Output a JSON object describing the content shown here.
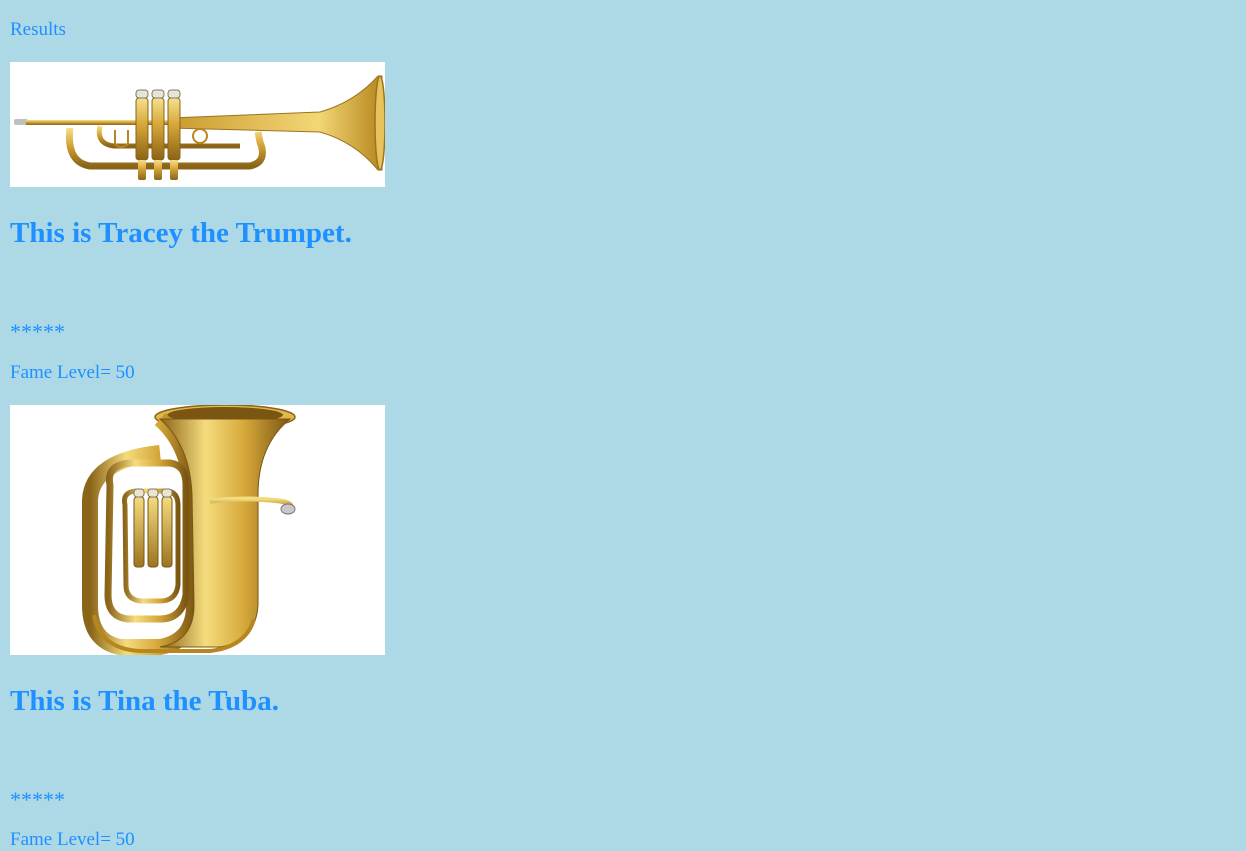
{
  "page": {
    "heading": "Results",
    "background_color": "#add8e6",
    "text_color": "#1e90ff"
  },
  "instruments": [
    {
      "image_icon": "trumpet-image",
      "title": "This is Tracey the Trumpet.",
      "stars": "*****",
      "fame": "Fame Level= 50"
    },
    {
      "image_icon": "tuba-image",
      "title": "This is Tina the Tuba.",
      "stars": "*****",
      "fame": "Fame Level= 50"
    }
  ]
}
